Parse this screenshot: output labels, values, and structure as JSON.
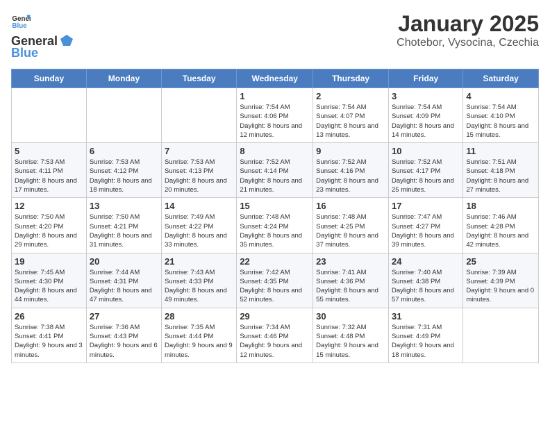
{
  "header": {
    "logo_general": "General",
    "logo_blue": "Blue",
    "title": "January 2025",
    "subtitle": "Chotebor, Vysocina, Czechia"
  },
  "calendar": {
    "days_of_week": [
      "Sunday",
      "Monday",
      "Tuesday",
      "Wednesday",
      "Thursday",
      "Friday",
      "Saturday"
    ],
    "weeks": [
      [
        {
          "day": "",
          "info": ""
        },
        {
          "day": "",
          "info": ""
        },
        {
          "day": "",
          "info": ""
        },
        {
          "day": "1",
          "info": "Sunrise: 7:54 AM\nSunset: 4:06 PM\nDaylight: 8 hours\nand 12 minutes."
        },
        {
          "day": "2",
          "info": "Sunrise: 7:54 AM\nSunset: 4:07 PM\nDaylight: 8 hours\nand 13 minutes."
        },
        {
          "day": "3",
          "info": "Sunrise: 7:54 AM\nSunset: 4:09 PM\nDaylight: 8 hours\nand 14 minutes."
        },
        {
          "day": "4",
          "info": "Sunrise: 7:54 AM\nSunset: 4:10 PM\nDaylight: 8 hours\nand 15 minutes."
        }
      ],
      [
        {
          "day": "5",
          "info": "Sunrise: 7:53 AM\nSunset: 4:11 PM\nDaylight: 8 hours\nand 17 minutes."
        },
        {
          "day": "6",
          "info": "Sunrise: 7:53 AM\nSunset: 4:12 PM\nDaylight: 8 hours\nand 18 minutes."
        },
        {
          "day": "7",
          "info": "Sunrise: 7:53 AM\nSunset: 4:13 PM\nDaylight: 8 hours\nand 20 minutes."
        },
        {
          "day": "8",
          "info": "Sunrise: 7:52 AM\nSunset: 4:14 PM\nDaylight: 8 hours\nand 21 minutes."
        },
        {
          "day": "9",
          "info": "Sunrise: 7:52 AM\nSunset: 4:16 PM\nDaylight: 8 hours\nand 23 minutes."
        },
        {
          "day": "10",
          "info": "Sunrise: 7:52 AM\nSunset: 4:17 PM\nDaylight: 8 hours\nand 25 minutes."
        },
        {
          "day": "11",
          "info": "Sunrise: 7:51 AM\nSunset: 4:18 PM\nDaylight: 8 hours\nand 27 minutes."
        }
      ],
      [
        {
          "day": "12",
          "info": "Sunrise: 7:50 AM\nSunset: 4:20 PM\nDaylight: 8 hours\nand 29 minutes."
        },
        {
          "day": "13",
          "info": "Sunrise: 7:50 AM\nSunset: 4:21 PM\nDaylight: 8 hours\nand 31 minutes."
        },
        {
          "day": "14",
          "info": "Sunrise: 7:49 AM\nSunset: 4:22 PM\nDaylight: 8 hours\nand 33 minutes."
        },
        {
          "day": "15",
          "info": "Sunrise: 7:48 AM\nSunset: 4:24 PM\nDaylight: 8 hours\nand 35 minutes."
        },
        {
          "day": "16",
          "info": "Sunrise: 7:48 AM\nSunset: 4:25 PM\nDaylight: 8 hours\nand 37 minutes."
        },
        {
          "day": "17",
          "info": "Sunrise: 7:47 AM\nSunset: 4:27 PM\nDaylight: 8 hours\nand 39 minutes."
        },
        {
          "day": "18",
          "info": "Sunrise: 7:46 AM\nSunset: 4:28 PM\nDaylight: 8 hours\nand 42 minutes."
        }
      ],
      [
        {
          "day": "19",
          "info": "Sunrise: 7:45 AM\nSunset: 4:30 PM\nDaylight: 8 hours\nand 44 minutes."
        },
        {
          "day": "20",
          "info": "Sunrise: 7:44 AM\nSunset: 4:31 PM\nDaylight: 8 hours\nand 47 minutes."
        },
        {
          "day": "21",
          "info": "Sunrise: 7:43 AM\nSunset: 4:33 PM\nDaylight: 8 hours\nand 49 minutes."
        },
        {
          "day": "22",
          "info": "Sunrise: 7:42 AM\nSunset: 4:35 PM\nDaylight: 8 hours\nand 52 minutes."
        },
        {
          "day": "23",
          "info": "Sunrise: 7:41 AM\nSunset: 4:36 PM\nDaylight: 8 hours\nand 55 minutes."
        },
        {
          "day": "24",
          "info": "Sunrise: 7:40 AM\nSunset: 4:38 PM\nDaylight: 8 hours\nand 57 minutes."
        },
        {
          "day": "25",
          "info": "Sunrise: 7:39 AM\nSunset: 4:39 PM\nDaylight: 9 hours\nand 0 minutes."
        }
      ],
      [
        {
          "day": "26",
          "info": "Sunrise: 7:38 AM\nSunset: 4:41 PM\nDaylight: 9 hours\nand 3 minutes."
        },
        {
          "day": "27",
          "info": "Sunrise: 7:36 AM\nSunset: 4:43 PM\nDaylight: 9 hours\nand 6 minutes."
        },
        {
          "day": "28",
          "info": "Sunrise: 7:35 AM\nSunset: 4:44 PM\nDaylight: 9 hours\nand 9 minutes."
        },
        {
          "day": "29",
          "info": "Sunrise: 7:34 AM\nSunset: 4:46 PM\nDaylight: 9 hours\nand 12 minutes."
        },
        {
          "day": "30",
          "info": "Sunrise: 7:32 AM\nSunset: 4:48 PM\nDaylight: 9 hours\nand 15 minutes."
        },
        {
          "day": "31",
          "info": "Sunrise: 7:31 AM\nSunset: 4:49 PM\nDaylight: 9 hours\nand 18 minutes."
        },
        {
          "day": "",
          "info": ""
        }
      ]
    ]
  }
}
